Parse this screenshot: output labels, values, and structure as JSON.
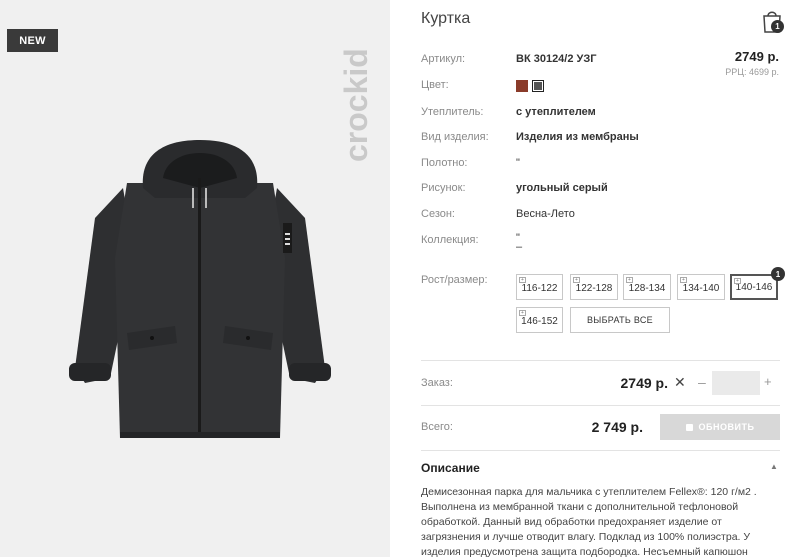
{
  "product": {
    "badge": "NEW",
    "brand": "crockid",
    "title": "Куртка",
    "cart_count": "1"
  },
  "details": [
    {
      "label": "Артикул:",
      "value": "ВК 30124/2 УЗГ"
    },
    {
      "label": "Цвет:",
      "value": ""
    },
    {
      "label": "Утеплитель:",
      "value": "с утеплителем"
    },
    {
      "label": "Вид изделия:",
      "value": "Изделия из мембраны"
    },
    {
      "label": "Полотно:",
      "value": "\""
    },
    {
      "label": "Рисунок:",
      "value": "угольный серый"
    },
    {
      "label": "Сезон:",
      "value": "Весна-Лето"
    },
    {
      "label": "Коллекция:",
      "value": "\""
    },
    {
      "label": "Рост/размер:",
      "value": ""
    }
  ],
  "collection_line2": "–",
  "price": {
    "main": "2749 р.",
    "rrp": "РРЦ: 4699 р."
  },
  "colors": {
    "swatch_1": "#8a3b2a",
    "swatch_2": "#555555"
  },
  "sizes": [
    "116-122",
    "122-128",
    "128-134",
    "134-140",
    "140-146",
    "146-152"
  ],
  "size_selected": "140-146",
  "size_selected_count": "1",
  "select_all_label": "ВЫБРАТЬ ВСЕ",
  "order": {
    "label": "Заказ:",
    "price": "2749 р.",
    "remove": "✕",
    "minus": "–",
    "plus": "+",
    "quantity": ""
  },
  "total": {
    "label": "Всего:",
    "value": "2 749 р.",
    "update_label": "ОБНОВИТЬ"
  },
  "description": {
    "title": "Описание",
    "toggle": "▲",
    "text": "Демисезонная парка для мальчика с утеплителем Fellex®: 120 г/м2 . Выполнена из мембранной ткани с дополнительной тефлоновой обработкой. Данный вид обработки предохраняет изделие от загрязнения и лучше отводит влагу. Подклад из 100% полиэстра. У изделия предусмотрена защита подбородка. Несъемный капюшон"
  }
}
